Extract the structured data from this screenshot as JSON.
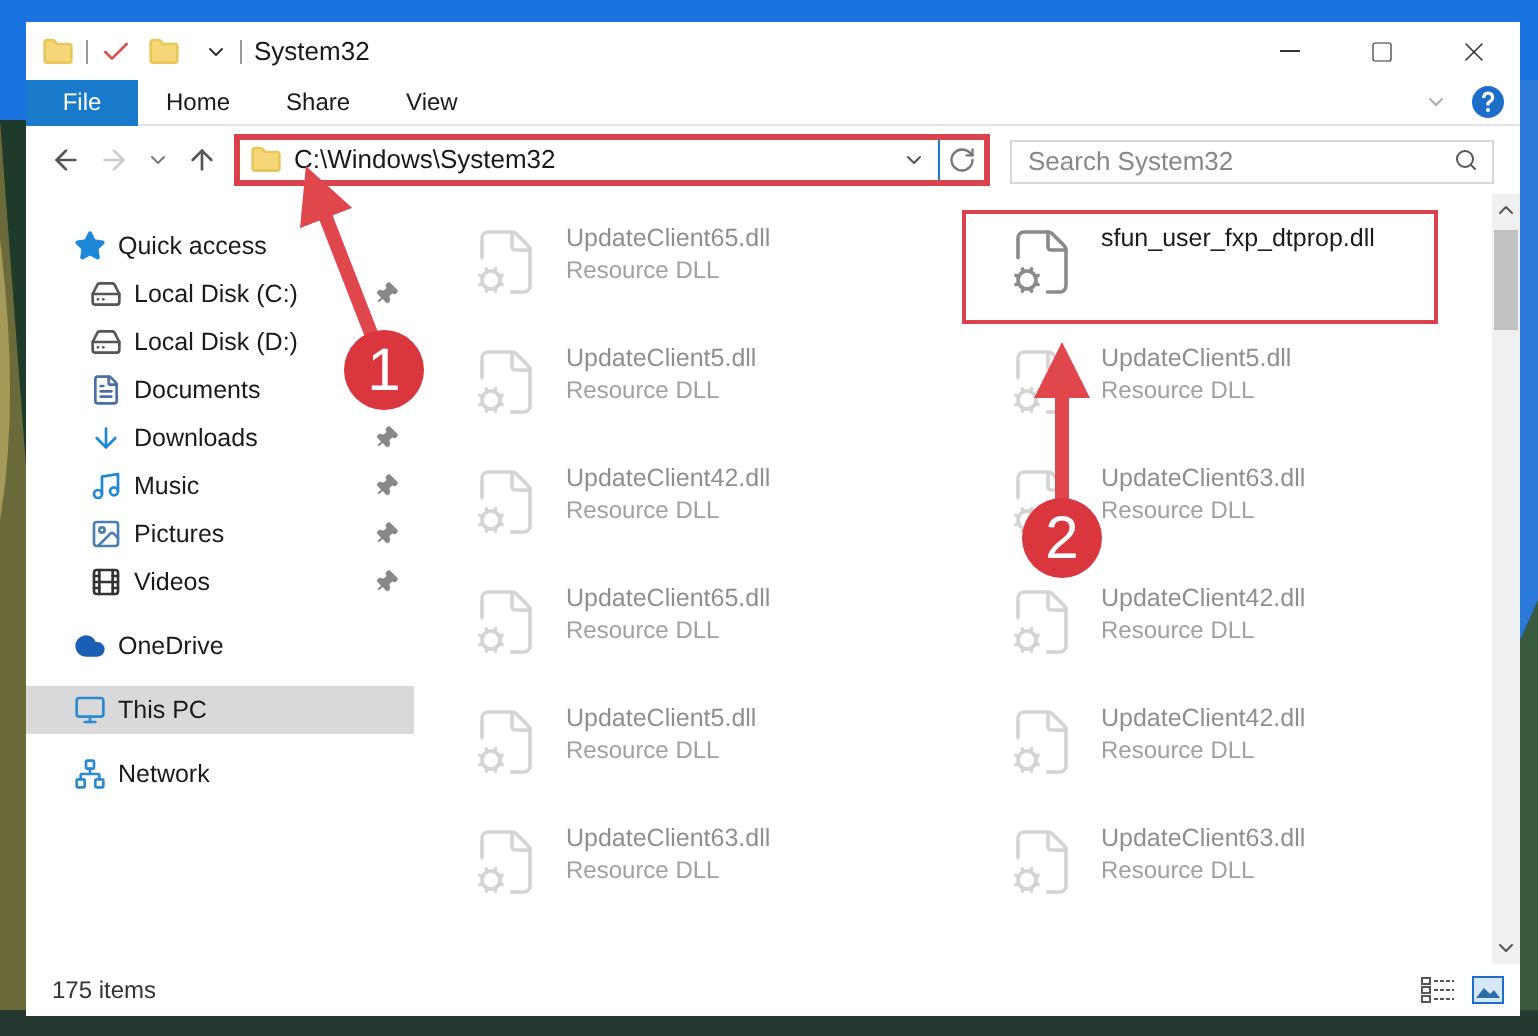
{
  "window": {
    "title": "System32"
  },
  "ribbon": {
    "file_button": "File",
    "tabs": [
      {
        "label": "Home",
        "selected": false
      },
      {
        "label": "Share",
        "selected": false
      },
      {
        "label": "View",
        "selected": false
      }
    ]
  },
  "address": {
    "path": "C:\\Windows\\System32",
    "highlighted": true
  },
  "search": {
    "placeholder": "Search System32"
  },
  "nav": {
    "items": [
      {
        "label": "Quick access",
        "kind": "star",
        "selected": false,
        "children": [
          {
            "label": "Local Disk (C:)",
            "kind": "drive-c",
            "pinned": true
          },
          {
            "label": "Local Disk (D:)",
            "kind": "drive"
          },
          {
            "label": "Documents",
            "kind": "documents"
          },
          {
            "label": "Downloads",
            "kind": "downloads",
            "pinned": true
          },
          {
            "label": "Music",
            "kind": "music",
            "pinned": true
          },
          {
            "label": "Pictures",
            "kind": "pictures",
            "pinned": true
          },
          {
            "label": "Videos",
            "kind": "videos",
            "pinned": true
          }
        ]
      },
      {
        "label": "OneDrive",
        "kind": "cloud",
        "selected": false
      },
      {
        "label": "This PC",
        "kind": "pc",
        "selected": true
      },
      {
        "label": "Network",
        "kind": "network",
        "selected": false
      }
    ]
  },
  "files": [
    {
      "name": "UpdateClient65.dll",
      "type": "Resource DLL",
      "faded": true,
      "highlighted": false
    },
    {
      "name": "sfun_user_fxp_dtprop.dll",
      "faded": false,
      "highlighted": true
    },
    {
      "name": "UpdateClient5.dll",
      "type": "Resource DLL",
      "faded": true,
      "highlighted": false
    },
    {
      "name": "UpdateClient5.dll",
      "type": "Resource DLL",
      "faded": true,
      "highlighted": false
    },
    {
      "name": "UpdateClient42.dll",
      "type": "Resource DLL",
      "faded": true,
      "highlighted": false
    },
    {
      "name": "UpdateClient63.dll",
      "type": "Resource DLL",
      "faded": true,
      "highlighted": false
    },
    {
      "name": "UpdateClient65.dll",
      "type": "Resource DLL",
      "faded": true,
      "highlighted": false
    },
    {
      "name": "UpdateClient42.dll",
      "type": "Resource DLL",
      "faded": true,
      "highlighted": false
    },
    {
      "name": "UpdateClient5.dll",
      "type": "Resource DLL",
      "faded": true,
      "highlighted": false
    },
    {
      "name": "UpdateClient42.dll",
      "type": "Resource DLL",
      "faded": true,
      "highlighted": false
    },
    {
      "name": "UpdateClient63.dll",
      "type": "Resource DLL",
      "faded": true,
      "highlighted": false
    },
    {
      "name": "UpdateClient63.dll",
      "type": "Resource DLL",
      "faded": true,
      "highlighted": false
    }
  ],
  "status_bar": {
    "count": "175 items"
  },
  "annotations": [
    {
      "label": "1"
    },
    {
      "label": "2"
    }
  ]
}
